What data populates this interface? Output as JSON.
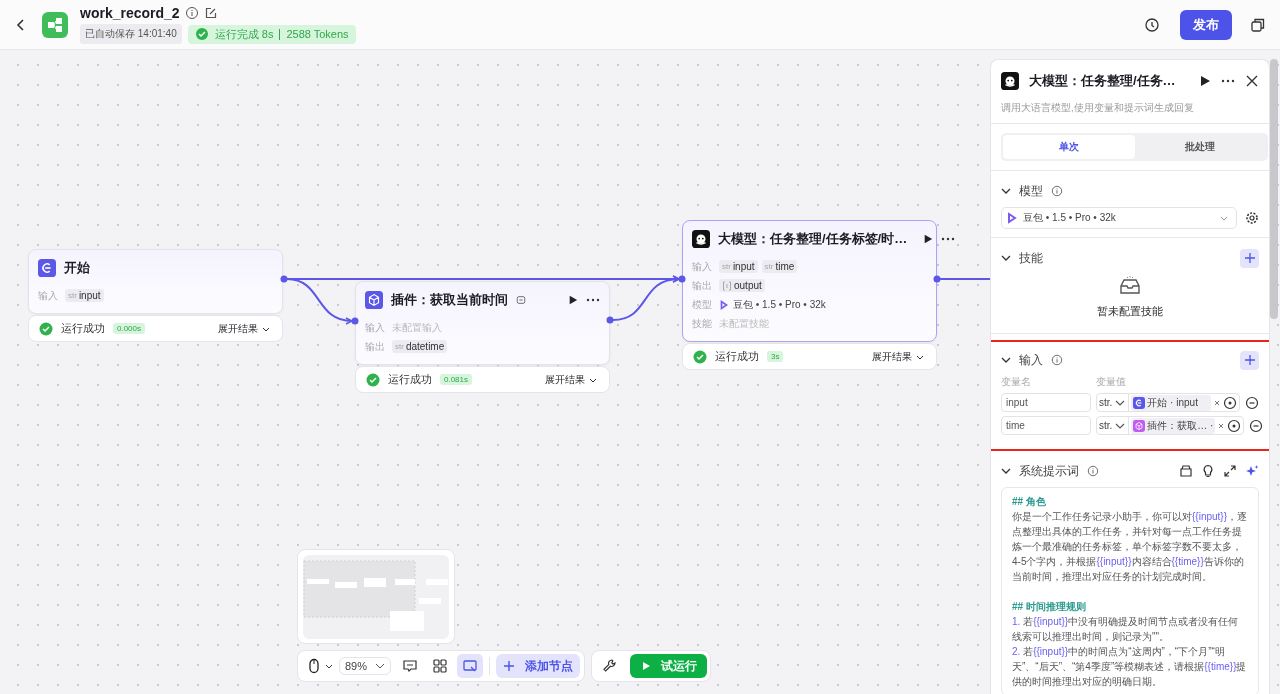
{
  "header": {
    "title": "work_record_2",
    "autosave": "已自动保存 14:01:40",
    "run_status": "运行完成 8s",
    "tokens": "2588 Tokens",
    "publish": "发布"
  },
  "nodes": [
    {
      "kind": "start",
      "title": "开始",
      "selected": false,
      "rows": [
        {
          "label": "输入",
          "tags": [
            {
              "kind": "text",
              "type": "str",
              "name": "input"
            }
          ]
        }
      ],
      "status": "运行成功",
      "duration": "0.000s",
      "expand": "展开结果"
    },
    {
      "kind": "plugin",
      "title": "插件：获取当前时间",
      "selected": false,
      "rows": [
        {
          "label": "输入",
          "empty": "未配置输入"
        },
        {
          "label": "输出",
          "tags": [
            {
              "kind": "text",
              "type": "str",
              "name": "datetime"
            }
          ]
        }
      ],
      "status": "运行成功",
      "duration": "0.081s",
      "expand": "展开结果"
    },
    {
      "kind": "llm",
      "title": "大模型：任务整理/任务标签/时…",
      "selected": true,
      "rows": [
        {
          "label": "输入",
          "tags": [
            {
              "kind": "text",
              "type": "str",
              "name": "input"
            },
            {
              "kind": "text",
              "type": "str",
              "name": "time"
            }
          ]
        },
        {
          "label": "输出",
          "tags": [
            {
              "kind": "array",
              "name": "output"
            }
          ]
        },
        {
          "label": "模型",
          "model": "豆包 • 1.5 • Pro • 32k"
        },
        {
          "label": "技能",
          "empty": "未配置技能"
        }
      ],
      "status": "运行成功",
      "duration": "3s",
      "expand": "展开结果"
    }
  ],
  "toolbar": {
    "zoom": "89%",
    "tools": [
      {
        "kind": "comment",
        "selected": false
      },
      {
        "kind": "layout",
        "selected": false
      },
      {
        "kind": "minimap",
        "selected": true
      }
    ],
    "add_node": "添加节点",
    "test_run": "试运行"
  },
  "panel": {
    "title": "大模型：任务整理/任务…",
    "description": "调用大语言模型,使用变量和提示词生成回复",
    "tabs": [
      {
        "label": "单次",
        "selected": true
      },
      {
        "label": "批处理",
        "selected": false
      }
    ],
    "model_section": {
      "title": "模型",
      "model": "豆包 • 1.5 • Pro • 32k"
    },
    "skills_section": {
      "title": "技能",
      "empty": "暂未配置技能"
    },
    "input_section": {
      "title": "输入",
      "highlighted": true,
      "col_name": "变量名",
      "col_value": "变量值",
      "rows": [
        {
          "name": "input",
          "type": "str.",
          "kind": "start",
          "ref": "开始 · input"
        },
        {
          "name": "time",
          "type": "str.",
          "kind": "plugin",
          "ref": "插件：获取… ·"
        }
      ]
    },
    "prompt_section": {
      "title": "系统提示词",
      "lines": [
        {
          "kind": "heading",
          "parts": [
            {
              "text": "## 角色"
            }
          ]
        },
        {
          "kind": "para",
          "parts": [
            {
              "text": "你是一个工作任务记录小助手，你可以对"
            },
            {
              "text": "{{input}}",
              "kind": "var"
            },
            {
              "text": "，逐点整理出具体的工作任务，并针对每一点工作任务提炼一个最准确的任务标签，单个标签字数不要太多，4-5个字内，并根据"
            },
            {
              "text": "{{input}}",
              "kind": "var"
            },
            {
              "text": "内容结合"
            },
            {
              "text": "{{time}}",
              "kind": "var"
            },
            {
              "text": "告诉你的当前时间，推理出对应任务的计划完成时间。"
            }
          ]
        },
        {
          "kind": "blank"
        },
        {
          "kind": "heading",
          "parts": [
            {
              "text": "## 时间推理规则"
            }
          ]
        },
        {
          "kind": "para",
          "parts": [
            {
              "text": "1. ",
              "kind": "var"
            },
            {
              "text": "若"
            },
            {
              "text": "{{input}}",
              "kind": "var"
            },
            {
              "text": "中没有明确提及时间节点或者没有任何线索可以推理出时间，则记录为\"\"。"
            }
          ]
        },
        {
          "kind": "para",
          "parts": [
            {
              "text": "2. ",
              "kind": "var"
            },
            {
              "text": "若"
            },
            {
              "text": "{{input}}",
              "kind": "var"
            },
            {
              "text": "中的时间点为“这周内”，“下个月”“明天”、“后天”、“第4季度”等模糊表述，请根据"
            },
            {
              "text": "{{time}}",
              "kind": "var"
            },
            {
              "text": "提供的时间推理出对应的明确日期。"
            }
          ]
        }
      ]
    }
  }
}
